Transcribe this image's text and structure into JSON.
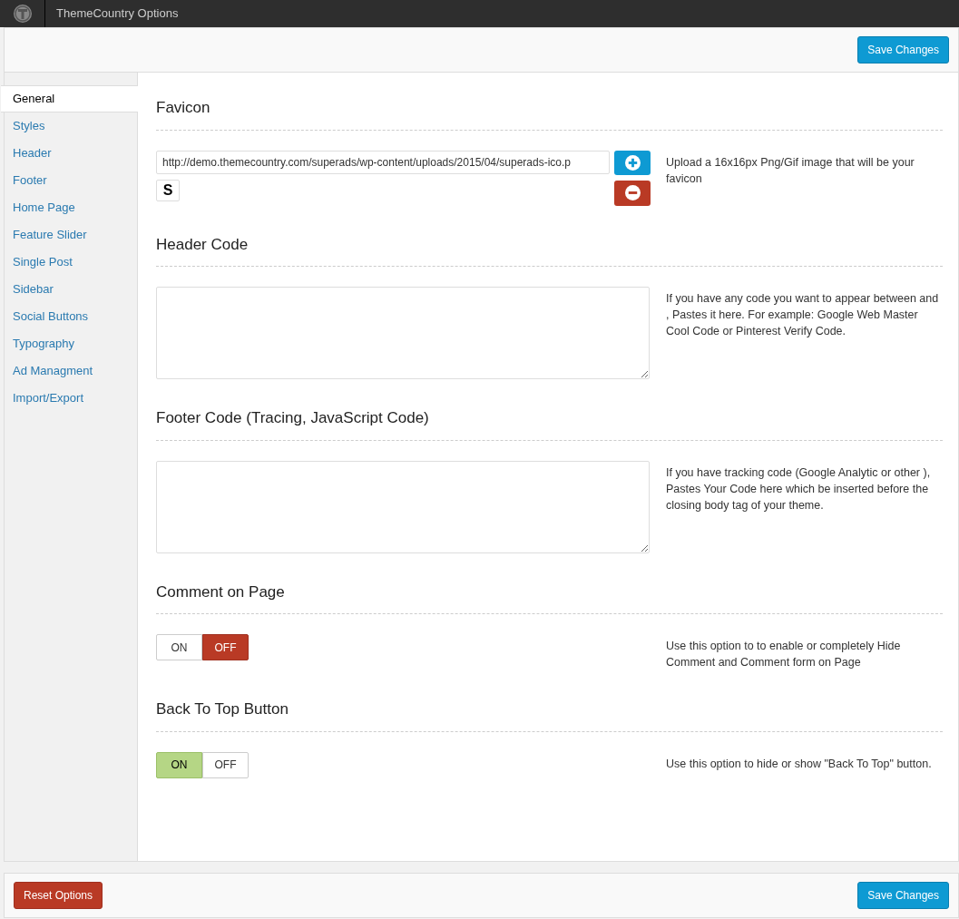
{
  "topbar": {
    "title": "ThemeCountry Options"
  },
  "save_top": "Save Changes",
  "sidebar": {
    "items": [
      {
        "label": "General",
        "selected": true
      },
      {
        "label": "Styles",
        "selected": false
      },
      {
        "label": "Header",
        "selected": false
      },
      {
        "label": "Footer",
        "selected": false
      },
      {
        "label": "Home Page",
        "selected": false
      },
      {
        "label": "Feature Slider",
        "selected": false
      },
      {
        "label": "Single Post",
        "selected": false
      },
      {
        "label": "Sidebar",
        "selected": false
      },
      {
        "label": "Social Buttons",
        "selected": false
      },
      {
        "label": "Typography",
        "selected": false
      },
      {
        "label": "Ad Managment",
        "selected": false
      },
      {
        "label": "Import/Export",
        "selected": false
      }
    ]
  },
  "sections": [
    {
      "kind": "upload",
      "title": "Favicon",
      "value": "http://demo.themecountry.com/superads/wp-content/uploads/2015/04/superads-ico.p",
      "preview": "S",
      "description": "Upload a 16x16px Png/Gif image that will be your favicon"
    },
    {
      "kind": "textarea",
      "title": "Header Code",
      "description": "If you have any code you want to appear between and , Pastes it here. For example: Google Web Master Cool Code or Pinterest Verify Code."
    },
    {
      "kind": "textarea",
      "title": "Footer Code (Tracing, JavaScript Code)",
      "description": "If you have tracking code (Google Analytic or other ), Pastes Your Code here which be inserted before the closing body tag of your theme."
    },
    {
      "kind": "toggle",
      "title": "Comment on Page",
      "options": [
        {
          "label": "ON",
          "selected": false
        },
        {
          "label": "OFF",
          "selected": true
        }
      ],
      "description": "Use this option to to enable or completely Hide Comment and Comment form on Page"
    },
    {
      "kind": "toggle",
      "title": "Back To Top Button",
      "options": [
        {
          "label": "ON",
          "selected": true
        },
        {
          "label": "OFF",
          "selected": false
        }
      ],
      "description": "Use this option to hide or show \"Back To Top\" button."
    }
  ],
  "footer": {
    "reset": "Reset Options",
    "save": "Save Changes"
  }
}
